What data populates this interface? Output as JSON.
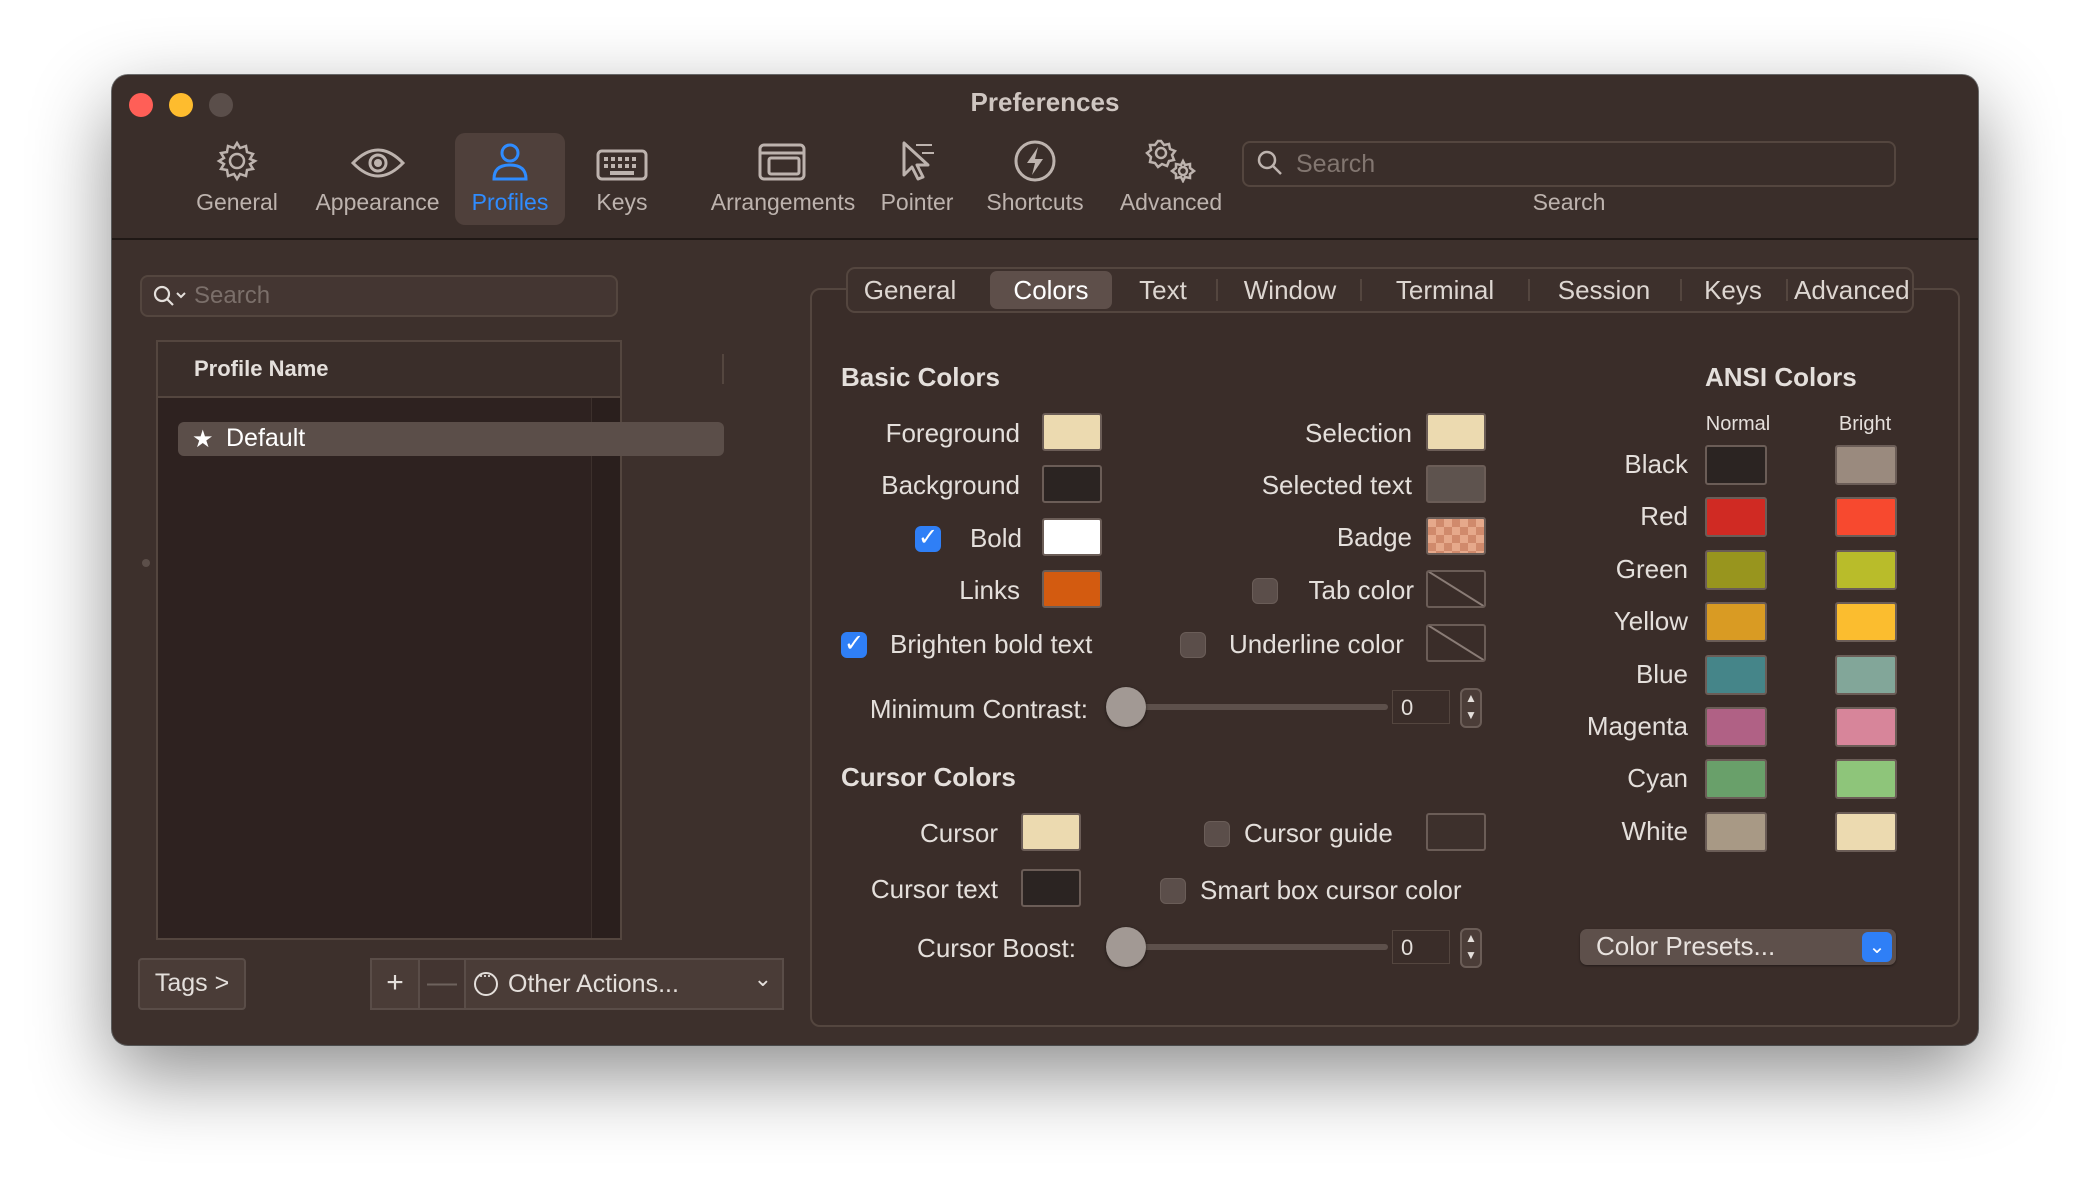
{
  "window": {
    "title": "Preferences"
  },
  "toolbar": {
    "items": [
      {
        "label": "General",
        "icon": "gear-icon"
      },
      {
        "label": "Appearance",
        "icon": "eye-icon"
      },
      {
        "label": "Profiles",
        "icon": "person-icon",
        "active": true
      },
      {
        "label": "Keys",
        "icon": "keyboard-icon"
      },
      {
        "label": "Arrangements",
        "icon": "windows-icon"
      },
      {
        "label": "Pointer",
        "icon": "pointer-icon"
      },
      {
        "label": "Shortcuts",
        "icon": "bolt-icon"
      },
      {
        "label": "Advanced",
        "icon": "gears-icon"
      }
    ],
    "search_placeholder": "Search",
    "search_label": "Search"
  },
  "profiles": {
    "search_placeholder": "Search",
    "column_header": "Profile Name",
    "rows": [
      {
        "name": "Default",
        "default": true
      }
    ],
    "tags_button": "Tags >",
    "add_button": "+",
    "remove_button": "—",
    "other_actions": "Other Actions..."
  },
  "tabs": {
    "items": [
      "General",
      "Colors",
      "Text",
      "Window",
      "Terminal",
      "Session",
      "Keys",
      "Advanced"
    ],
    "active": "Colors"
  },
  "basic_colors": {
    "title": "Basic Colors",
    "foreground": {
      "label": "Foreground",
      "color": "#ecdab0"
    },
    "background": {
      "label": "Background",
      "color": "#2b2422"
    },
    "bold": {
      "label": "Bold",
      "color": "#ffffff",
      "checked": true
    },
    "links": {
      "label": "Links",
      "color": "#d35b10"
    },
    "selection": {
      "label": "Selection",
      "color": "#ecdab0"
    },
    "selected_text": {
      "label": "Selected text",
      "color": "#5e534e"
    },
    "badge": {
      "label": "Badge",
      "color": "#e6a98b"
    },
    "tab_color": {
      "label": "Tab color",
      "checked": false
    },
    "underline_color": {
      "label": "Underline color",
      "checked": false
    },
    "brighten_bold": {
      "label": "Brighten bold text",
      "checked": true
    },
    "min_contrast": {
      "label": "Minimum Contrast:",
      "value": "0"
    }
  },
  "cursor_colors": {
    "title": "Cursor Colors",
    "cursor": {
      "label": "Cursor",
      "color": "#ecdab0"
    },
    "cursor_text": {
      "label": "Cursor text",
      "color": "#2b2422"
    },
    "cursor_guide": {
      "label": "Cursor guide",
      "checked": false,
      "color": "#3d302c"
    },
    "smart_box": {
      "label": "Smart box cursor color",
      "checked": false
    },
    "cursor_boost": {
      "label": "Cursor Boost:",
      "value": "0"
    }
  },
  "ansi": {
    "title": "ANSI Colors",
    "normal_header": "Normal",
    "bright_header": "Bright",
    "rows": [
      {
        "name": "Black",
        "normal": "#2b2422",
        "bright": "#9a8a7e"
      },
      {
        "name": "Red",
        "normal": "#d02a23",
        "bright": "#f7492f"
      },
      {
        "name": "Green",
        "normal": "#98951e",
        "bright": "#b9bc2a"
      },
      {
        "name": "Yellow",
        "normal": "#d99b23",
        "bright": "#fbbd2f"
      },
      {
        "name": "Blue",
        "normal": "#458589",
        "bright": "#82a699"
      },
      {
        "name": "Magenta",
        "normal": "#b06185",
        "bright": "#d7859a"
      },
      {
        "name": "Cyan",
        "normal": "#69a06a",
        "bright": "#8ec57a"
      },
      {
        "name": "White",
        "normal": "#a89985",
        "bright": "#ecdab0"
      }
    ]
  },
  "color_presets": "Color Presets..."
}
